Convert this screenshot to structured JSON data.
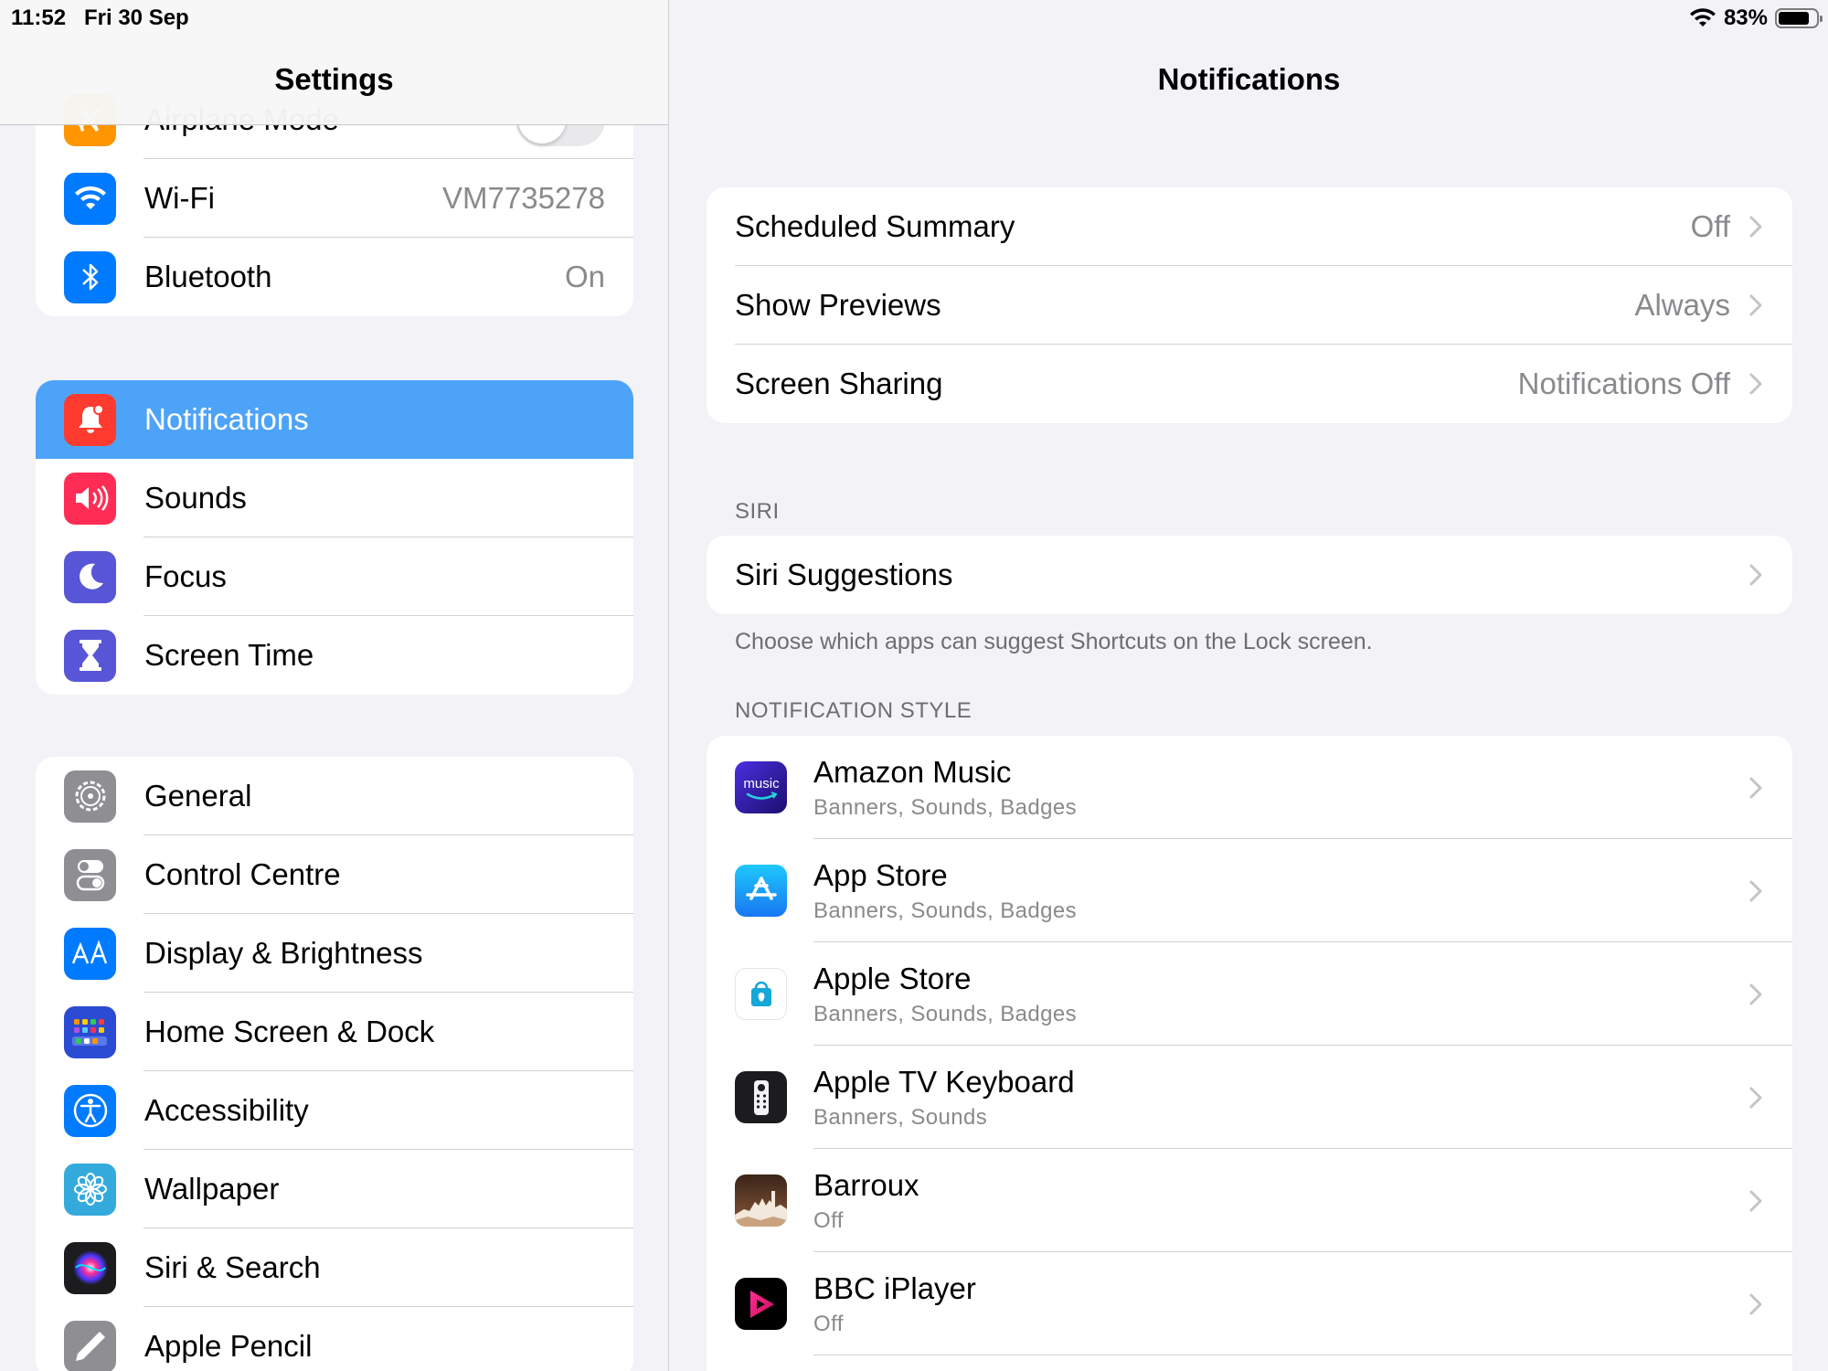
{
  "status": {
    "time": "11:52",
    "date": "Fri 30 Sep",
    "battery": "83%",
    "battery_level": 0.83
  },
  "sidebar": {
    "title": "Settings",
    "group1": [
      {
        "label": "Airplane Mode",
        "icon": "airplane-icon",
        "color": "#ff9500"
      },
      {
        "label": "Wi-Fi",
        "value": "VM7735278",
        "icon": "wifi-icon",
        "color": "#007aff"
      },
      {
        "label": "Bluetooth",
        "value": "On",
        "icon": "bluetooth-icon",
        "color": "#007aff"
      }
    ],
    "group2": [
      {
        "label": "Notifications",
        "icon": "bell-icon",
        "color": "#ff3b30"
      },
      {
        "label": "Sounds",
        "icon": "speaker-icon",
        "color": "#ff2d55"
      },
      {
        "label": "Focus",
        "icon": "moon-icon",
        "color": "#5856d6"
      },
      {
        "label": "Screen Time",
        "icon": "hourglass-icon",
        "color": "#5856d6"
      }
    ],
    "group3": [
      {
        "label": "General",
        "icon": "gear-icon",
        "color": "#8e8e93"
      },
      {
        "label": "Control Centre",
        "icon": "switches-icon",
        "color": "#8e8e93"
      },
      {
        "label": "Display & Brightness",
        "icon": "text-size-icon",
        "color": "#007aff"
      },
      {
        "label": "Home Screen & Dock",
        "icon": "grid-icon",
        "color": "#2c4bd3"
      },
      {
        "label": "Accessibility",
        "icon": "accessibility-icon",
        "color": "#007aff"
      },
      {
        "label": "Wallpaper",
        "icon": "flower-icon",
        "color": "#34aadc"
      },
      {
        "label": "Siri & Search",
        "icon": "siri-icon",
        "color": "#1c1c1e"
      },
      {
        "label": "Apple Pencil",
        "icon": "pencil-icon",
        "color": "#8e8e93"
      }
    ]
  },
  "detail": {
    "title": "Notifications",
    "top_rows": [
      {
        "label": "Scheduled Summary",
        "value": "Off"
      },
      {
        "label": "Show Previews",
        "value": "Always"
      },
      {
        "label": "Screen Sharing",
        "value": "Notifications Off"
      }
    ],
    "siri_header": "SIRI",
    "siri_row": {
      "label": "Siri Suggestions"
    },
    "siri_footnote": "Choose which apps can suggest Shortcuts on the Lock screen.",
    "style_header": "NOTIFICATION STYLE",
    "icon_music_text": "music",
    "apps": [
      {
        "name": "Amazon Music",
        "sub": "Banners, Sounds, Badges",
        "icon": "amazon-music-icon"
      },
      {
        "name": "App Store",
        "sub": "Banners, Sounds, Badges",
        "icon": "app-store-icon"
      },
      {
        "name": "Apple Store",
        "sub": "Banners, Sounds, Badges",
        "icon": "apple-store-icon"
      },
      {
        "name": "Apple TV Keyboard",
        "sub": "Banners, Sounds",
        "icon": "apple-tv-remote-icon"
      },
      {
        "name": "Barroux",
        "sub": "Off",
        "icon": "barroux-icon"
      },
      {
        "name": "BBC iPlayer",
        "sub": "Off",
        "icon": "bbc-iplayer-icon"
      }
    ]
  }
}
